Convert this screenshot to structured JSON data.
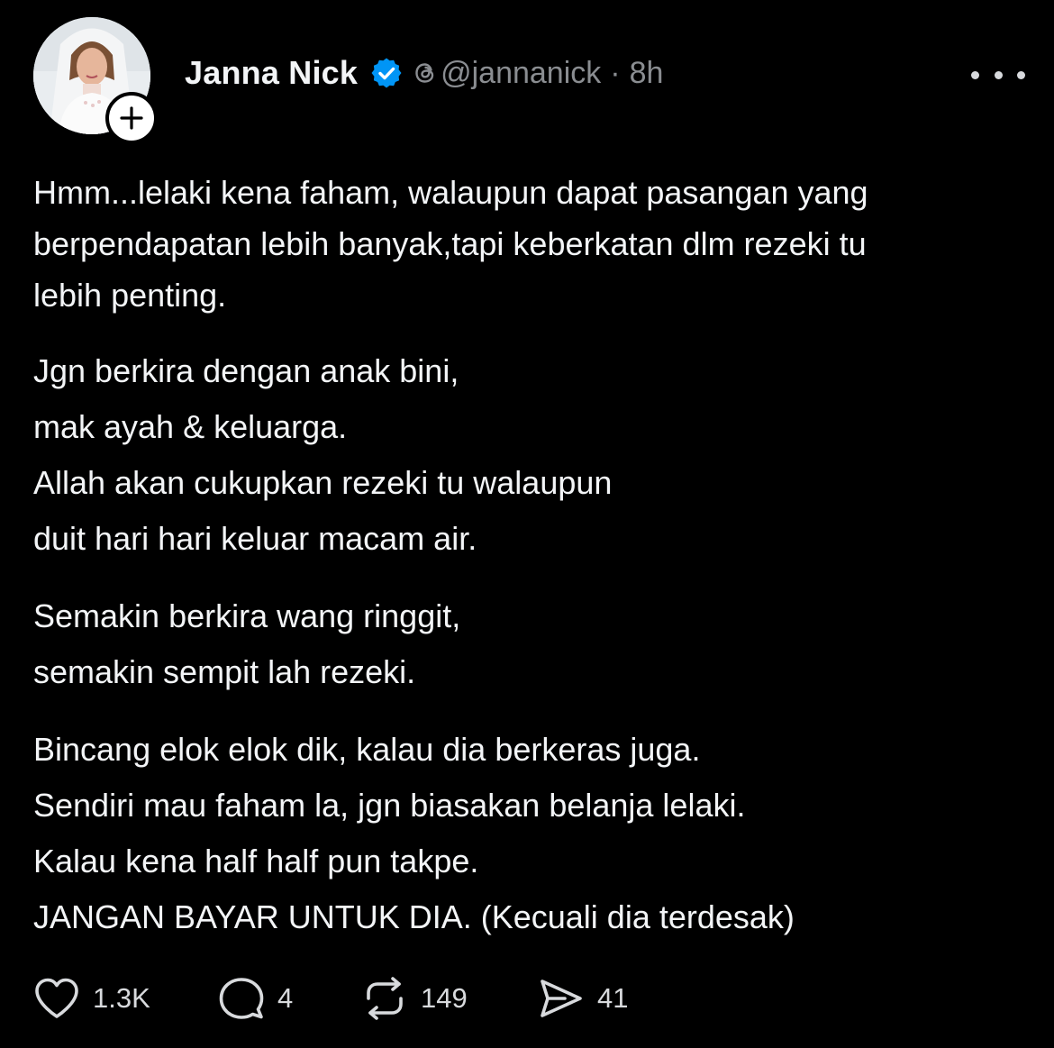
{
  "post": {
    "author": {
      "name": "Janna Nick",
      "handle": "@jannanick",
      "separator": "·",
      "time": "8h",
      "avatar_icon": "profile-photo",
      "verified_icon": "verified-badge-icon",
      "verified_color": "#0095f6"
    },
    "paragraphs": [
      [
        "Hmm...lelaki kena faham, walaupun dapat pasangan yang",
        "berpendapatan lebih banyak,tapi keberkatan dlm rezeki tu",
        "lebih penting."
      ],
      [
        "Jgn berkira dengan anak bini,",
        "mak ayah & keluarga.",
        "Allah akan cukupkan rezeki tu walaupun",
        "duit hari hari keluar macam air."
      ],
      [
        "Semakin berkira wang ringgit,",
        "semakin sempit lah rezeki."
      ],
      [
        "Bincang elok elok dik, kalau dia berkeras juga.",
        "Sendiri mau faham la, jgn biasakan belanja lelaki.",
        "Kalau kena half half pun takpe.",
        "JANGAN BAYAR UNTUK DIA. (Kecuali dia terdesak)"
      ]
    ],
    "actions": {
      "likes": "1.3K",
      "replies": "4",
      "reposts": "149",
      "shares": "41"
    }
  },
  "colors": {
    "background": "#000000",
    "primary_text": "#f3f5f7",
    "secondary_text": "#8a8d91"
  }
}
